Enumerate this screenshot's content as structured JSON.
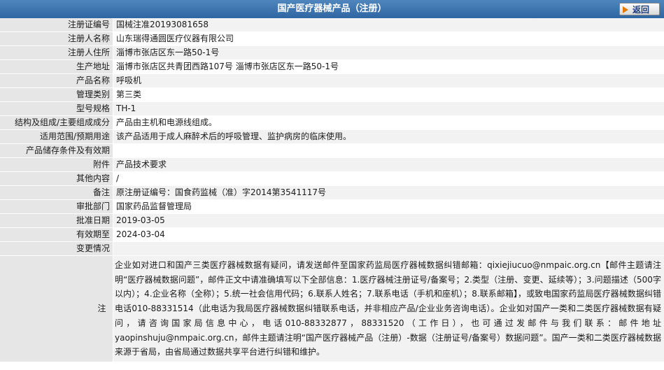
{
  "header": {
    "title": "国产医疗器械产品（注册）",
    "back_label": "返回"
  },
  "rows": [
    {
      "label": "注册证编号",
      "value": "国械注准20193081658"
    },
    {
      "label": "注册人名称",
      "value": "山东瑞得通圆医疗仪器有限公司"
    },
    {
      "label": "注册人住所",
      "value": "淄博市张店区东一路50-1号"
    },
    {
      "label": "生产地址",
      "value": "淄博市张店区共青团西路107号 淄博市张店区东一路50-1号"
    },
    {
      "label": "产品名称",
      "value": "呼吸机"
    },
    {
      "label": "管理类别",
      "value": "第三类"
    },
    {
      "label": "型号规格",
      "value": "TH-1"
    },
    {
      "label": "结构及组成/主要组成成分",
      "value": "产品由主机和电源线组成。"
    },
    {
      "label": "适用范围/预期用途",
      "value": "该产品适用于成人麻醉术后的呼吸管理、监护病房的临床使用。"
    },
    {
      "label": "产品储存条件及有效期",
      "value": ""
    },
    {
      "label": "附件",
      "value": "产品技术要求"
    },
    {
      "label": "其他内容",
      "value": "/"
    },
    {
      "label": "备注",
      "value": "原注册证编号：国食药监械（准）字2014第3541117号"
    },
    {
      "label": "审批部门",
      "value": "国家药品监督管理局"
    },
    {
      "label": "批准日期",
      "value": "2019-03-05"
    },
    {
      "label": "有效期至",
      "value": "2024-03-04"
    },
    {
      "label": "变更情况",
      "value": ""
    }
  ],
  "note": {
    "label": "注",
    "text": "企业如对进口和国产三类医疗器械数据有疑问，请发送邮件至国家药监局医疗器械数据纠错邮箱：qixiejiucuo@nmpaic.org.cn【邮件主题请注明“医疗器械数据问题”，邮件正文中请准确填写以下全部信息：1.医疗器械注册证号/备案号；2.类型（注册、变更、延续等）；3.问题描述（500字以内）；4.企业名称（全称）；5.统一社会信用代码；6.联系人姓名；7.联系电话（手机和座机）；8.联系邮箱】，或致电国家药监局医疗器械数据纠错电话010-88331514（此电话为我局医疗器械数据纠错联系电话，并非相应产品/企业业务咨询电话）。企业如对国产一类和二类医疗器械数据有疑问，请咨询国家局信息中心，电话010-88332877，88331520（工作日），也可通过发邮件与我们联系：邮件地址yaopinshuju@nmpaic.org.cn，邮件主题请注明“国产医疗器械产品（注册）-数据（注册证号/备案号）数据问题”。国产一类和二类医疗器械数据来源于省局，由省局通过数据共享平台进行纠错和维护。"
  }
}
